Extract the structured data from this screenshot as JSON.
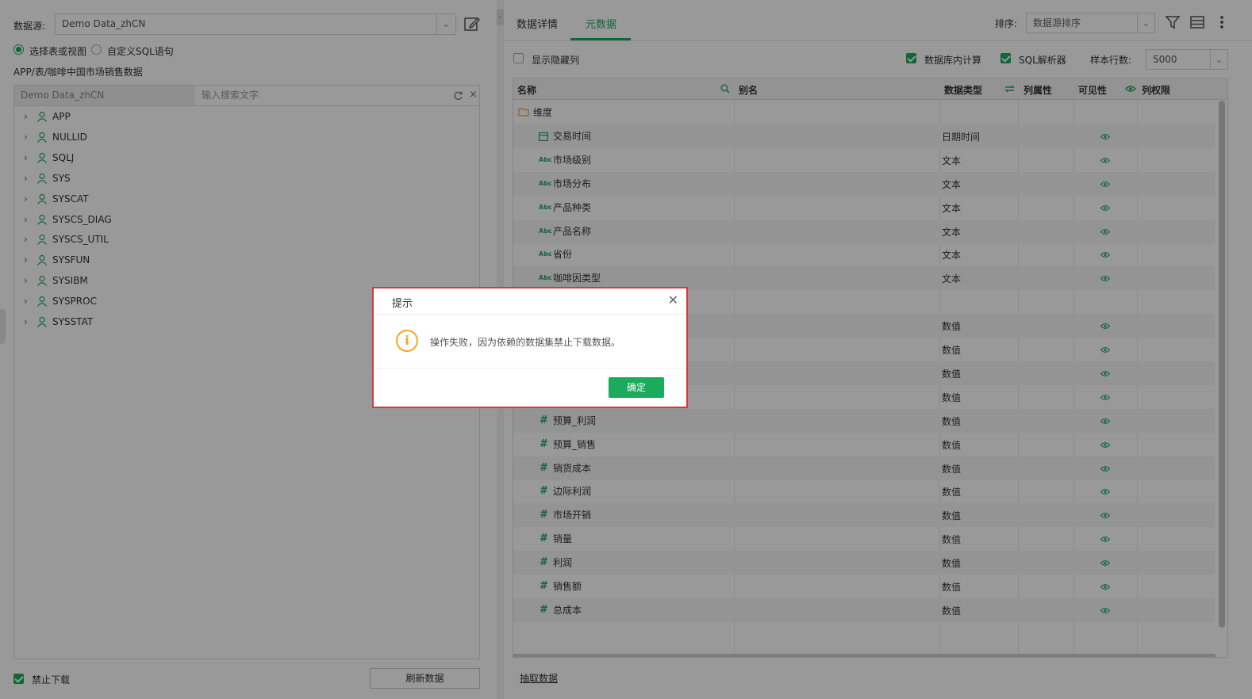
{
  "left": {
    "datasource_label": "数据源:",
    "datasource_value": "Demo Data_zhCN",
    "radio_table": "选择表或视图",
    "radio_sql": "自定义SQL语句",
    "path": "APP/表/咖啡中国市场销售数据",
    "search_source": "Demo Data_zhCN",
    "search_placeholder": "输入搜索文字",
    "tree": [
      "APP",
      "NULLID",
      "SQLJ",
      "SYS",
      "SYSCAT",
      "SYSCS_DIAG",
      "SYSCS_UTIL",
      "SYSFUN",
      "SYSIBM",
      "SYSPROC",
      "SYSSTAT"
    ],
    "forbid_download": "禁止下载",
    "refresh_button": "刷新数据"
  },
  "right": {
    "tabs": [
      "数据详情",
      "元数据"
    ],
    "active_tab": 1,
    "sort_label": "排序:",
    "sort_value": "数据源排序",
    "show_hidden": "显示隐藏列",
    "db_compute": "数据库内计算",
    "sql_parser": "SQL解析器",
    "sample_label": "样本行数:",
    "sample_value": "5000",
    "columns": {
      "name": "名称",
      "alias": "别名",
      "type": "数据类型",
      "attr": "列属性",
      "visible": "可见性",
      "perm": "列权限"
    },
    "group_dimension": "维度",
    "dimensions": [
      {
        "name": "交易时间",
        "type": "日期时间",
        "icon": "calendar-icon"
      },
      {
        "name": "市场级别",
        "type": "文本",
        "icon": "abc-icon"
      },
      {
        "name": "市场分布",
        "type": "文本",
        "icon": "abc-icon"
      },
      {
        "name": "产品种类",
        "type": "文本",
        "icon": "abc-icon"
      },
      {
        "name": "产品名称",
        "type": "文本",
        "icon": "abc-icon"
      },
      {
        "name": "省份",
        "type": "文本",
        "icon": "abc-icon"
      },
      {
        "name": "咖啡因类型",
        "type": "文本",
        "icon": "abc-icon"
      }
    ],
    "hidden_measure_types": [
      "数值",
      "数值",
      "数值",
      "数值"
    ],
    "measures": [
      {
        "name": "预算_利润",
        "type": "数值"
      },
      {
        "name": "预算_销售",
        "type": "数值"
      },
      {
        "name": "销货成本",
        "type": "数值"
      },
      {
        "name": "边际利润",
        "type": "数值"
      },
      {
        "name": "市场开销",
        "type": "数值"
      },
      {
        "name": "销量",
        "type": "数值"
      },
      {
        "name": "利润",
        "type": "数值"
      },
      {
        "name": "销售额",
        "type": "数值"
      },
      {
        "name": "总成本",
        "type": "数值"
      }
    ],
    "abc_glyph": "Abc",
    "hash_glyph": "#",
    "extract_link": "抽取数据"
  },
  "dialog": {
    "title": "提示",
    "message": "操作失败，因为依赖的数据集禁止下载数据。",
    "ok_button": "确定"
  },
  "colors": {
    "accent": "#1aab5c",
    "warning": "#f5a623",
    "highlight_border": "#d9383f"
  }
}
